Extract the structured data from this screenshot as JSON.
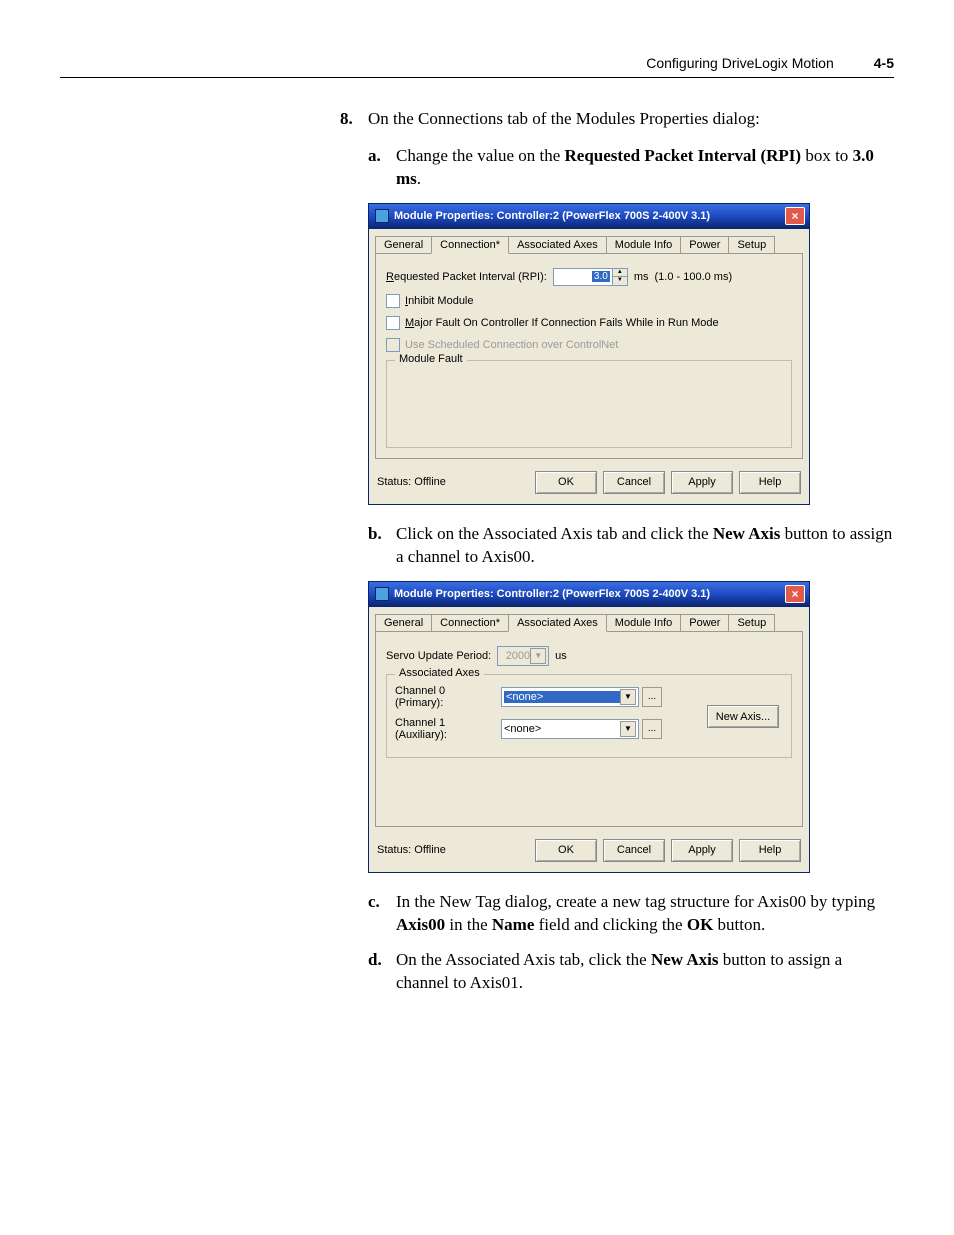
{
  "header": {
    "title": "Configuring DriveLogix Motion",
    "page": "4-5"
  },
  "step8": {
    "num": "8.",
    "text": "On the Connections tab of the Modules Properties dialog:"
  },
  "sub_a": {
    "letter": "a.",
    "t1": "Change the value on the ",
    "b1": "Requested Packet Interval (RPI)",
    "t2": " box to ",
    "b2": "3.0 ms",
    "t3": "."
  },
  "dialog1": {
    "title": "Module Properties: Controller:2 (PowerFlex 700S 2-400V 3.1)",
    "tabs": [
      "General",
      "Connection*",
      "Associated Axes",
      "Module Info",
      "Power",
      "Setup"
    ],
    "active_tab": 1,
    "rpi_label_pre": "R",
    "rpi_label": "equested Packet Interval (RPI):",
    "rpi_value": "3.0",
    "rpi_unit": "ms",
    "rpi_range": "(1.0 - 100.0 ms)",
    "chk_inhibit_pre": "I",
    "chk_inhibit": "nhibit Module",
    "chk_major_pre": "M",
    "chk_major": "ajor Fault On Controller If Connection Fails While in Run Mode",
    "chk_sched": "Use Scheduled Connection over ControlNet",
    "group_fault": "Module Fault",
    "status": "Status: Offline",
    "buttons": {
      "ok": "OK",
      "cancel": "Cancel",
      "apply": "Apply",
      "help": "Help"
    }
  },
  "sub_b": {
    "letter": "b.",
    "t1": "Click on the Associated Axis tab and click the ",
    "b1": "New Axis",
    "t2": " button to assign a channel to Axis00."
  },
  "dialog2": {
    "title": "Module Properties: Controller:2 (PowerFlex 700S 2-400V 3.1)",
    "tabs": [
      "General",
      "Connection*",
      "Associated Axes",
      "Module Info",
      "Power",
      "Setup"
    ],
    "active_tab": 2,
    "servo_label": "Servo Update Period:",
    "servo_value": "2000",
    "servo_unit": "us",
    "group_axes": "Associated Axes",
    "ch0_label": "Channel 0 (Primary):",
    "ch0_value": "<none>",
    "ch1_label": "Channel 1 (Auxiliary):",
    "ch1_value": "<none>",
    "new_axis": "New Axis...",
    "status": "Status: Offline",
    "buttons": {
      "ok": "OK",
      "cancel": "Cancel",
      "apply": "Apply",
      "help": "Help"
    }
  },
  "sub_c": {
    "letter": "c.",
    "t1": "In the New Tag dialog, create a new tag structure for Axis00 by typing ",
    "b1": "Axis00",
    "t2": " in the ",
    "b2": "Name",
    "t3": " field and clicking the ",
    "b3": "OK",
    "t4": " button."
  },
  "sub_d": {
    "letter": "d.",
    "t1": "On the Associated Axis tab, click the ",
    "b1": "New Axis",
    "t2": " button to assign a channel to Axis01."
  }
}
